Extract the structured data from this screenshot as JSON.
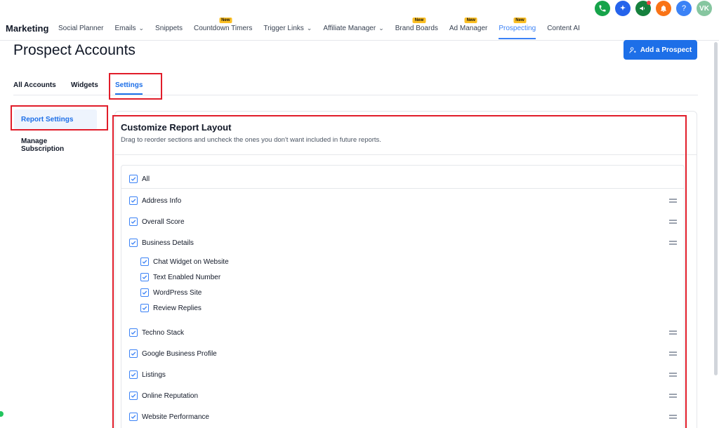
{
  "app": {
    "section": "Marketing"
  },
  "nav": [
    {
      "label": "Social Planner",
      "caret": false,
      "badge": ""
    },
    {
      "label": "Emails",
      "caret": true,
      "badge": ""
    },
    {
      "label": "Snippets",
      "caret": false,
      "badge": ""
    },
    {
      "label": "Countdown Timers",
      "caret": false,
      "badge": "New"
    },
    {
      "label": "Trigger Links",
      "caret": true,
      "badge": ""
    },
    {
      "label": "Affiliate Manager",
      "caret": true,
      "badge": ""
    },
    {
      "label": "Brand Boards",
      "caret": false,
      "badge": "New"
    },
    {
      "label": "Ad Manager",
      "caret": false,
      "badge": "New"
    },
    {
      "label": "Prospecting",
      "caret": false,
      "badge": "New",
      "active": true
    },
    {
      "label": "Content AI",
      "caret": false,
      "badge": ""
    }
  ],
  "top_icons": [
    {
      "name": "phone-icon",
      "color": "#16a34a",
      "glyph": ""
    },
    {
      "name": "ai-sparkle-icon",
      "color": "#2563eb",
      "glyph": ""
    },
    {
      "name": "megaphone-icon",
      "color": "#15803d",
      "glyph": ""
    },
    {
      "name": "bell-icon",
      "color": "#f97316",
      "glyph": ""
    },
    {
      "name": "help-icon",
      "color": "#3b82f6",
      "glyph": "?"
    },
    {
      "name": "avatar",
      "color": "#86c6a0",
      "glyph": "VK"
    }
  ],
  "page": {
    "title": "Prospect Accounts",
    "add_button": "Add a Prospect"
  },
  "tabs": [
    "All Accounts",
    "Widgets",
    "Settings"
  ],
  "side_menu": [
    "Report Settings",
    "Manage Subscription"
  ],
  "report": {
    "title": "Customize Report Layout",
    "subtitle": "Drag to reorder sections and uncheck the ones you don't want included in future reports.",
    "all_label": "All",
    "sections": [
      {
        "label": "Address Info",
        "checked": true
      },
      {
        "label": "Overall Score",
        "checked": true
      },
      {
        "label": "Business Details",
        "checked": true
      },
      {
        "label": "Chat Widget on Website",
        "checked": true,
        "sub": true
      },
      {
        "label": "Text Enabled Number",
        "checked": true,
        "sub": true
      },
      {
        "label": "WordPress Site",
        "checked": true,
        "sub": true
      },
      {
        "label": "Review Replies",
        "checked": true,
        "sub": true
      },
      {
        "label": "Techno Stack",
        "checked": true
      },
      {
        "label": "Google Business Profile",
        "checked": true
      },
      {
        "label": "Listings",
        "checked": true
      },
      {
        "label": "Online Reputation",
        "checked": true
      },
      {
        "label": "Website Performance",
        "checked": true
      }
    ]
  },
  "colors": {
    "accent": "#1d6fe8",
    "highlight": "#e11d2a"
  }
}
